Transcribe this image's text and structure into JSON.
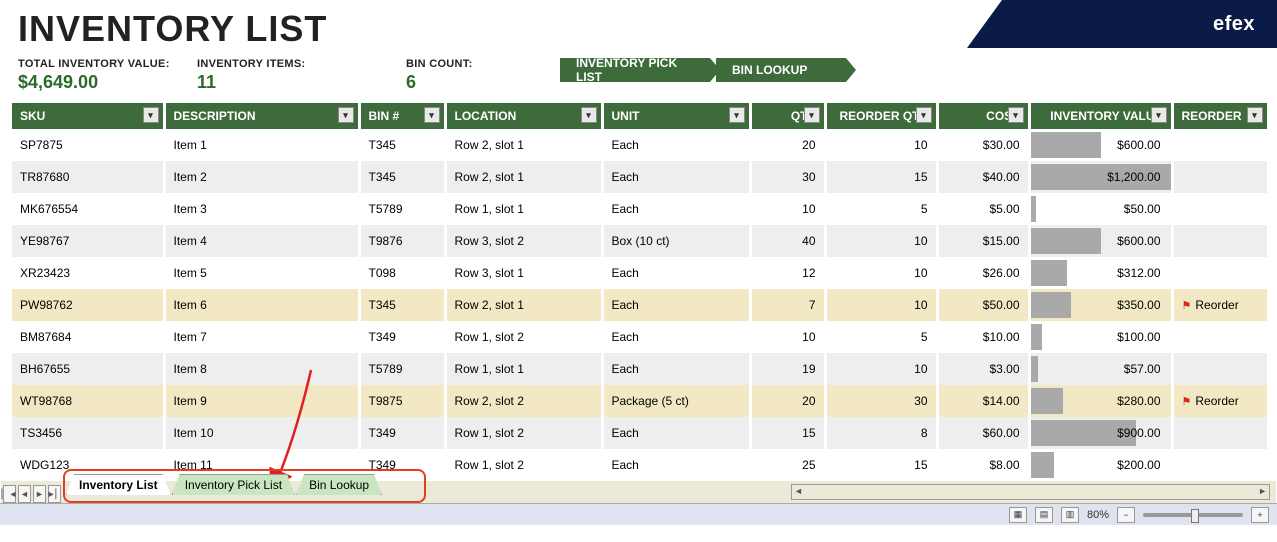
{
  "brand": "efex",
  "title": "INVENTORY LIST",
  "summary": {
    "total_label": "TOTAL INVENTORY VALUE:",
    "total_value": "$4,649.00",
    "items_label": "INVENTORY ITEMS:",
    "items_value": "11",
    "bin_label": "BIN COUNT:",
    "bin_value": "6"
  },
  "nav": {
    "pick": "INVENTORY PICK LIST",
    "lookup": "BIN LOOKUP"
  },
  "headers": {
    "sku": "SKU",
    "desc": "DESCRIPTION",
    "bin": "BIN #",
    "loc": "LOCATION",
    "unit": "UNIT",
    "qty": "QTY",
    "rqty": "REORDER QTY",
    "cost": "COST",
    "inv": "INVENTORY VALUE",
    "reorder": "REORDER"
  },
  "rows": [
    {
      "sku": "SP7875",
      "desc": "Item 1",
      "bin": "T345",
      "loc": "Row 2, slot 1",
      "unit": "Each",
      "qty": "20",
      "rqty": "10",
      "cost": "$30.00",
      "inv": "$600.00",
      "bar": 50,
      "hl": false,
      "reorder": ""
    },
    {
      "sku": "TR87680",
      "desc": "Item 2",
      "bin": "T345",
      "loc": "Row 2, slot 1",
      "unit": "Each",
      "qty": "30",
      "rqty": "15",
      "cost": "$40.00",
      "inv": "$1,200.00",
      "bar": 100,
      "hl": false,
      "reorder": ""
    },
    {
      "sku": "MK676554",
      "desc": "Item 3",
      "bin": "T5789",
      "loc": "Row 1, slot 1",
      "unit": "Each",
      "qty": "10",
      "rqty": "5",
      "cost": "$5.00",
      "inv": "$50.00",
      "bar": 4,
      "hl": false,
      "reorder": ""
    },
    {
      "sku": "YE98767",
      "desc": "Item 4",
      "bin": "T9876",
      "loc": "Row 3, slot 2",
      "unit": "Box (10 ct)",
      "qty": "40",
      "rqty": "10",
      "cost": "$15.00",
      "inv": "$600.00",
      "bar": 50,
      "hl": false,
      "reorder": ""
    },
    {
      "sku": "XR23423",
      "desc": "Item 5",
      "bin": "T098",
      "loc": "Row 3, slot 1",
      "unit": "Each",
      "qty": "12",
      "rqty": "10",
      "cost": "$26.00",
      "inv": "$312.00",
      "bar": 26,
      "hl": false,
      "reorder": ""
    },
    {
      "sku": "PW98762",
      "desc": "Item 6",
      "bin": "T345",
      "loc": "Row 2, slot 1",
      "unit": "Each",
      "qty": "7",
      "rqty": "10",
      "cost": "$50.00",
      "inv": "$350.00",
      "bar": 29,
      "hl": true,
      "reorder": "Reorder",
      "flag": true
    },
    {
      "sku": "BM87684",
      "desc": "Item 7",
      "bin": "T349",
      "loc": "Row 1, slot 2",
      "unit": "Each",
      "qty": "10",
      "rqty": "5",
      "cost": "$10.00",
      "inv": "$100.00",
      "bar": 8,
      "hl": false,
      "reorder": ""
    },
    {
      "sku": "BH67655",
      "desc": "Item 8",
      "bin": "T5789",
      "loc": "Row 1, slot 1",
      "unit": "Each",
      "qty": "19",
      "rqty": "10",
      "cost": "$3.00",
      "inv": "$57.00",
      "bar": 5,
      "hl": false,
      "reorder": ""
    },
    {
      "sku": "WT98768",
      "desc": "Item 9",
      "bin": "T9875",
      "loc": "Row 2, slot 2",
      "unit": "Package (5 ct)",
      "qty": "20",
      "rqty": "30",
      "cost": "$14.00",
      "inv": "$280.00",
      "bar": 23,
      "hl": true,
      "reorder": "Reorder",
      "flag": true
    },
    {
      "sku": "TS3456",
      "desc": "Item 10",
      "bin": "T349",
      "loc": "Row 1, slot 2",
      "unit": "Each",
      "qty": "15",
      "rqty": "8",
      "cost": "$60.00",
      "inv": "$900.00",
      "bar": 75,
      "hl": false,
      "reorder": ""
    },
    {
      "sku": "WDG123",
      "desc": "Item 11",
      "bin": "T349",
      "loc": "Row 1, slot 2",
      "unit": "Each",
      "qty": "25",
      "rqty": "15",
      "cost": "$8.00",
      "inv": "$200.00",
      "bar": 17,
      "hl": false,
      "reorder": ""
    }
  ],
  "tabs": {
    "t1": "Inventory List",
    "t2": "Inventory Pick List",
    "t3": "Bin Lookup"
  },
  "status": {
    "zoom": "80%"
  }
}
